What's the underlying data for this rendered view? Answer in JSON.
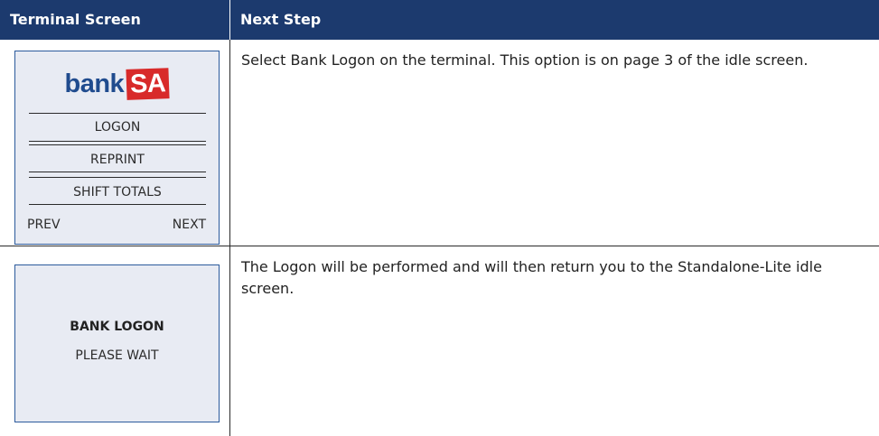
{
  "header": {
    "col1": "Terminal Screen",
    "col2": "Next Step"
  },
  "rows": [
    {
      "screen": {
        "logo_bank": "bank",
        "logo_sa": "SA",
        "menu": [
          "LOGON",
          "REPRINT",
          "SHIFT TOTALS"
        ],
        "prev": "PREV",
        "next": "NEXT"
      },
      "step": "Select Bank Logon on the terminal. This option is on page 3 of the idle screen."
    },
    {
      "screen": {
        "title": "BANK LOGON",
        "subtitle": "PLEASE WAIT"
      },
      "step": "The Logon will be performed and will then return you to the Standalone-Lite idle screen."
    }
  ],
  "colors": {
    "header_bg": "#1c3a6e",
    "screen_bg": "#e8ebf3",
    "screen_border": "#2b5a9c",
    "logo_blue": "#1f4b8e",
    "logo_red": "#d82a2a"
  }
}
